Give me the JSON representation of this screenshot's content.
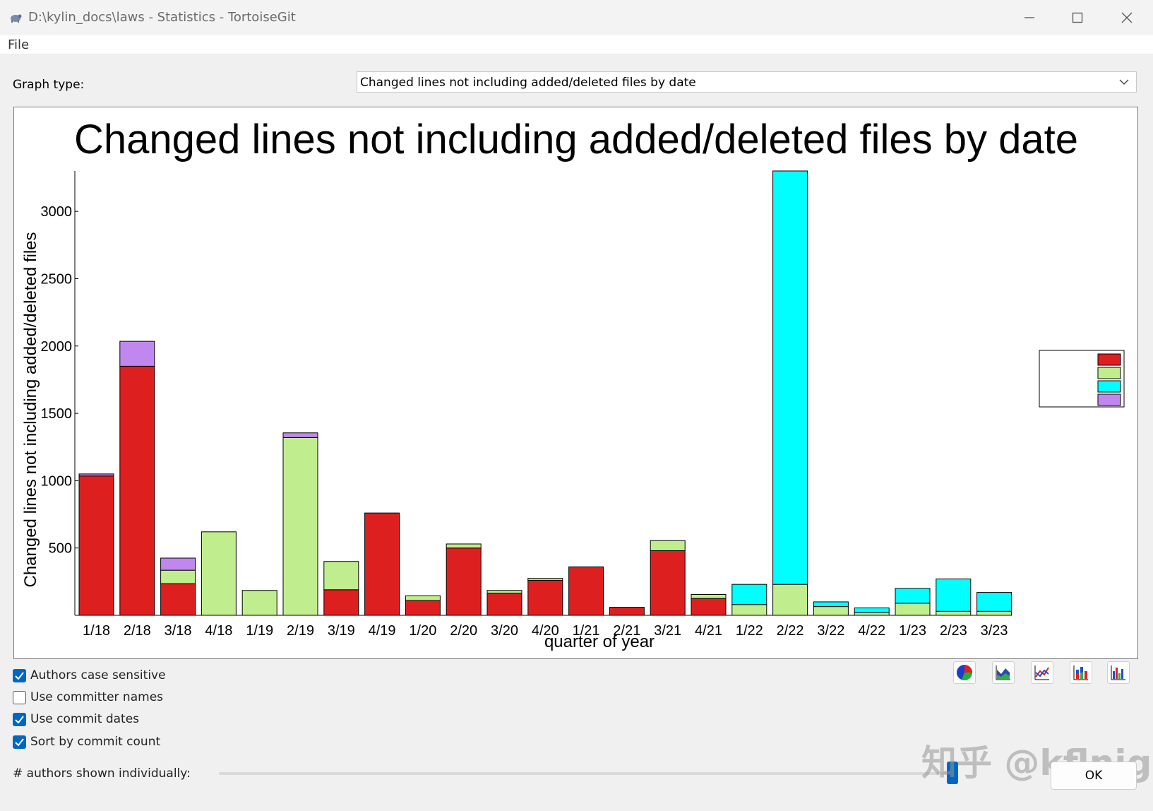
{
  "window": {
    "title": "D:\\kylin_docs\\laws - Statistics - TortoiseGit"
  },
  "menu": {
    "file": "File"
  },
  "graph_type": {
    "label": "Graph type:",
    "selected": "Changed lines not including added/deleted files by date"
  },
  "chart_data": {
    "type": "bar",
    "stacked": true,
    "title": "Changed lines not including added/deleted files by date",
    "xlabel": "quarter of year",
    "ylabel": "Changed lines not including added/deleted files",
    "ylim": [
      0,
      3300
    ],
    "yticks": [
      500,
      1000,
      1500,
      2000,
      2500,
      3000
    ],
    "categories": [
      "1/18",
      "2/18",
      "3/18",
      "4/18",
      "1/19",
      "2/19",
      "3/19",
      "4/19",
      "1/20",
      "2/20",
      "3/20",
      "4/20",
      "1/21",
      "2/21",
      "3/21",
      "4/21",
      "1/22",
      "2/22",
      "3/22",
      "4/22",
      "1/23",
      "2/23",
      "3/23"
    ],
    "series": [
      {
        "color": "#dd1f1f",
        "values": [
          1035,
          1850,
          235,
          0,
          0,
          0,
          190,
          760,
          110,
          500,
          165,
          260,
          360,
          60,
          480,
          125,
          0,
          0,
          0,
          0,
          0,
          0,
          0
        ]
      },
      {
        "color": "#c0ee8e",
        "values": [
          0,
          0,
          100,
          620,
          185,
          1320,
          210,
          0,
          35,
          30,
          20,
          15,
          0,
          0,
          75,
          30,
          80,
          230,
          65,
          20,
          90,
          30,
          30
        ]
      },
      {
        "color": "#00ffff",
        "values": [
          0,
          0,
          0,
          0,
          0,
          0,
          0,
          0,
          0,
          0,
          0,
          0,
          0,
          0,
          0,
          0,
          150,
          3070,
          35,
          35,
          110,
          240,
          140
        ]
      },
      {
        "color": "#c088ee",
        "values": [
          15,
          185,
          90,
          0,
          0,
          35,
          0,
          0,
          0,
          0,
          0,
          0,
          0,
          0,
          0,
          0,
          0,
          0,
          0,
          0,
          0,
          0,
          0
        ]
      }
    ],
    "legend": {
      "position": "right"
    },
    "grid": false
  },
  "options": {
    "authors_case_sensitive": "Authors case sensitive",
    "use_committer_names": "Use committer names",
    "use_commit_dates": "Use commit dates",
    "sort_by_commit_count": "Sort by commit count"
  },
  "authors_shown": {
    "label": "# authors shown individually:"
  },
  "ok": "OK",
  "watermark": "知乎 @kflnig",
  "colors": {
    "accent": "#0067c0"
  }
}
